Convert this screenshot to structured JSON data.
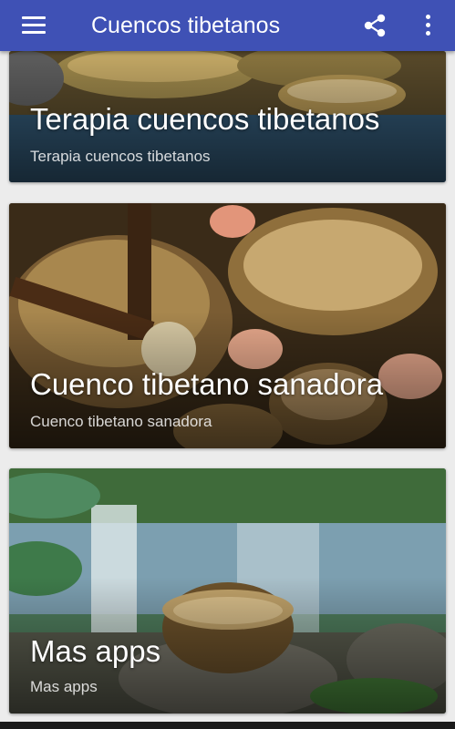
{
  "app": {
    "title": "Cuencos tibetanos",
    "accent_color": "#3f51b5",
    "menu_icon": "hamburger-menu-icon",
    "share_icon": "share-icon",
    "more_icon": "more-vert-icon"
  },
  "cards": [
    {
      "title": "Terapia cuencos tibetanos",
      "subtitle": "Terapia cuencos tibetanos",
      "image": "singing bowls on water"
    },
    {
      "title": "Cuenco tibetano sanadora",
      "subtitle": "Cuenco tibetano sanadora",
      "image": "singing bowls with mallet and petals"
    },
    {
      "title": "Mas apps",
      "subtitle": "Mas apps",
      "image": "singing bowl on rock near pond"
    }
  ]
}
